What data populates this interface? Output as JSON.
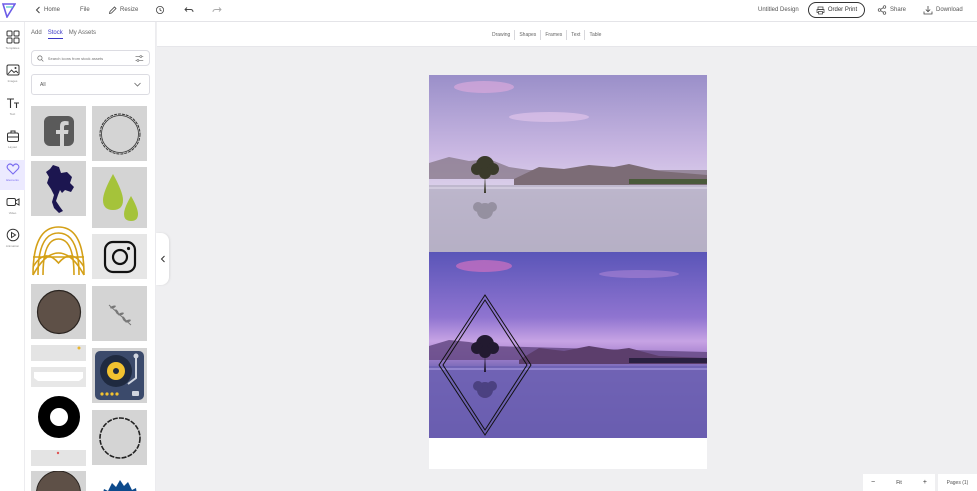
{
  "topbar": {
    "home": "Home",
    "file": "File",
    "resize": "Resize",
    "design_title": "Untitled Design",
    "order_prints": "Order Print",
    "share": "Share",
    "download": "Download"
  },
  "rail": {
    "items": [
      {
        "label": "Templates",
        "icon": "grid-icon"
      },
      {
        "label": "Images",
        "icon": "image-icon"
      },
      {
        "label": "Text",
        "icon": "text-icon"
      },
      {
        "label": "Layout",
        "icon": "briefcase-icon"
      },
      {
        "label": "Elements",
        "icon": "heart-icon"
      },
      {
        "label": "Video",
        "icon": "video-icon"
      },
      {
        "label": "Animation",
        "icon": "play-circle-icon"
      }
    ]
  },
  "panel": {
    "tabs": [
      "Add",
      "Stock",
      "My Assets"
    ],
    "search_placeholder": "Search icons from stock assets",
    "filter_value": "All"
  },
  "toolbar": {
    "items": [
      "Drawing",
      "Shapes",
      "Frames",
      "Text",
      "Table"
    ]
  },
  "zoom": {
    "value": "Fit",
    "minus": "−",
    "plus": "+"
  },
  "pages": {
    "label": "Pages (1)"
  },
  "colors": {
    "accent": "#3a36c6",
    "elements_active_bg": "#eceaff"
  }
}
